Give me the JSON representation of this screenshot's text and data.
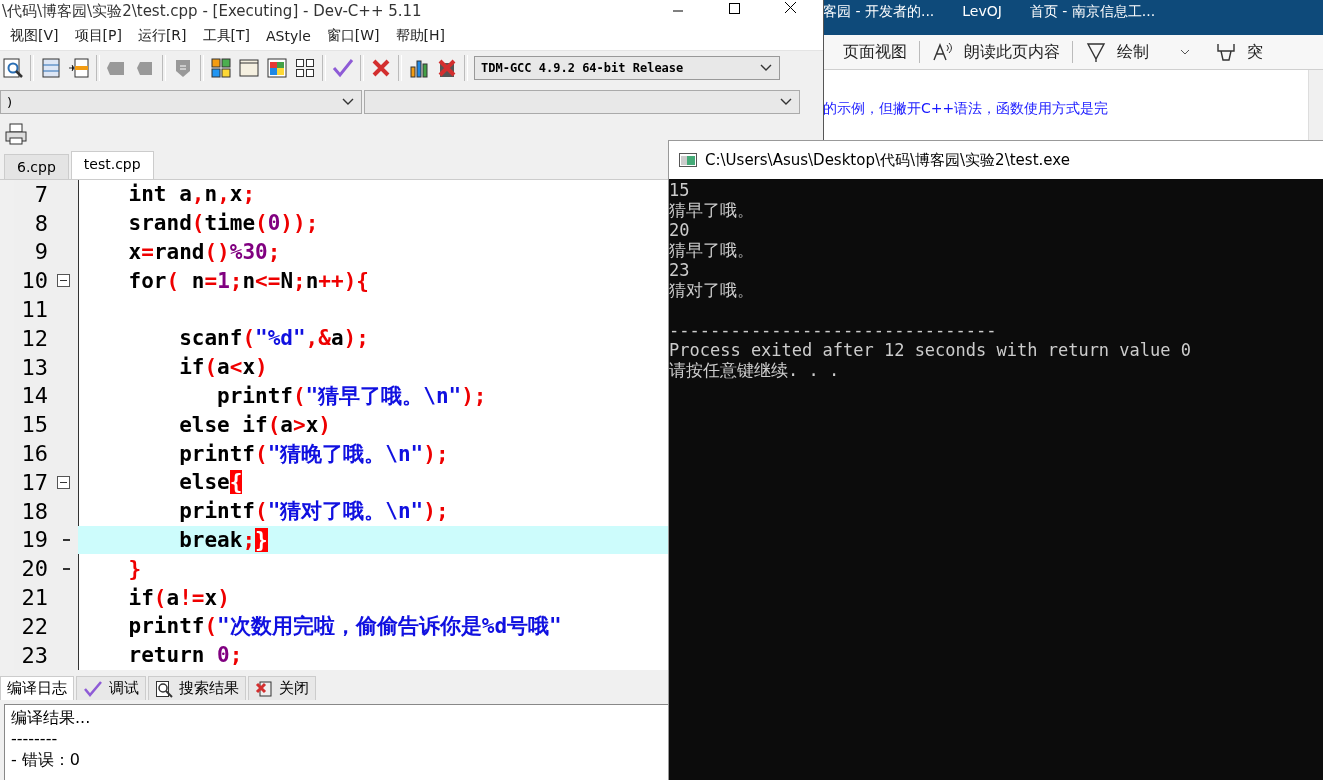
{
  "browser": {
    "tabs": [
      {
        "label": "客园 - 开发者的..."
      },
      {
        "label": "LevOJ"
      },
      {
        "label": "首页 - 南京信息工..."
      }
    ],
    "toolbar": [
      {
        "kind": "view",
        "label": "页面视图"
      },
      {
        "kind": "read",
        "label": "朗读此页内容"
      },
      {
        "kind": "draw",
        "label": "绘制"
      },
      {
        "kind": "highlight",
        "label": "突"
      }
    ],
    "content": "的示例，但撇开C++语法，函数使用方式是完"
  },
  "ide": {
    "title": "\\代码\\博客园\\实验2\\test.cpp - [Executing] - Dev-C++ 5.11",
    "menu": [
      "视图[V]",
      "项目[P]",
      "运行[R]",
      "工具[T]",
      "AStyle",
      "窗口[W]",
      "帮助[H]"
    ],
    "compiler": "TDM-GCC 4.9.2 64-bit Release",
    "class_dropdown": ")",
    "tabs": [
      {
        "label": "6.cpp",
        "selected": false
      },
      {
        "label": "test.cpp",
        "selected": true
      }
    ],
    "lines": [
      {
        "number": "7",
        "kind": "plain",
        "current": false,
        "tokens": [
          {
            "kind": "kw",
            "text": "    int "
          },
          {
            "kind": "id",
            "text": "a"
          },
          {
            "kind": "op",
            "text": ","
          },
          {
            "kind": "id",
            "text": "n"
          },
          {
            "kind": "op",
            "text": ","
          },
          {
            "kind": "id",
            "text": "x"
          },
          {
            "kind": "op",
            "text": ";"
          }
        ]
      },
      {
        "number": "8",
        "kind": "plain",
        "current": false,
        "tokens": [
          {
            "kind": "id",
            "text": "    srand"
          },
          {
            "kind": "op",
            "text": "("
          },
          {
            "kind": "id",
            "text": "time"
          },
          {
            "kind": "op",
            "text": "("
          },
          {
            "kind": "num",
            "text": "0"
          },
          {
            "kind": "op",
            "text": "));"
          }
        ]
      },
      {
        "number": "9",
        "kind": "plain",
        "current": false,
        "tokens": [
          {
            "kind": "id",
            "text": "    x"
          },
          {
            "kind": "op",
            "text": "="
          },
          {
            "kind": "id",
            "text": "rand"
          },
          {
            "kind": "op",
            "text": "()"
          },
          {
            "kind": "num",
            "text": "%30"
          },
          {
            "kind": "op",
            "text": ";"
          }
        ]
      },
      {
        "number": "10",
        "kind": "fold_start",
        "current": false,
        "tokens": [
          {
            "kind": "kw",
            "text": "    for"
          },
          {
            "kind": "op",
            "text": "( "
          },
          {
            "kind": "id",
            "text": "n"
          },
          {
            "kind": "op",
            "text": "="
          },
          {
            "kind": "num",
            "text": "1"
          },
          {
            "kind": "op",
            "text": ";"
          },
          {
            "kind": "id",
            "text": "n"
          },
          {
            "kind": "op",
            "text": "<="
          },
          {
            "kind": "id",
            "text": "N"
          },
          {
            "kind": "op",
            "text": ";"
          },
          {
            "kind": "id",
            "text": "n"
          },
          {
            "kind": "op",
            "text": "++){"
          }
        ]
      },
      {
        "number": "11",
        "kind": "plain",
        "current": false
      },
      {
        "number": "12",
        "kind": "plain",
        "current": false,
        "tokens": [
          {
            "kind": "id",
            "text": "        scanf"
          },
          {
            "kind": "op",
            "text": "("
          },
          {
            "kind": "str",
            "text": "\"%d\""
          },
          {
            "kind": "op",
            "text": ",&"
          },
          {
            "kind": "id",
            "text": "a"
          },
          {
            "kind": "op",
            "text": ");"
          }
        ]
      },
      {
        "number": "13",
        "kind": "plain",
        "current": false,
        "tokens": [
          {
            "kind": "kw",
            "text": "        if"
          },
          {
            "kind": "op",
            "text": "("
          },
          {
            "kind": "id",
            "text": "a"
          },
          {
            "kind": "op",
            "text": "<"
          },
          {
            "kind": "id",
            "text": "x"
          },
          {
            "kind": "op",
            "text": ")"
          }
        ]
      },
      {
        "number": "14",
        "kind": "plain",
        "current": false,
        "tokens": [
          {
            "kind": "id",
            "text": "           printf"
          },
          {
            "kind": "op",
            "text": "("
          },
          {
            "kind": "str",
            "text": "\"猜早了哦。\\n\""
          },
          {
            "kind": "op",
            "text": ");"
          }
        ]
      },
      {
        "number": "15",
        "kind": "plain",
        "current": false,
        "tokens": [
          {
            "kind": "kw",
            "text": "        else if"
          },
          {
            "kind": "op",
            "text": "("
          },
          {
            "kind": "id",
            "text": "a"
          },
          {
            "kind": "op",
            "text": ">"
          },
          {
            "kind": "id",
            "text": "x"
          },
          {
            "kind": "op",
            "text": ")"
          }
        ]
      },
      {
        "number": "16",
        "kind": "plain",
        "current": false,
        "tokens": [
          {
            "kind": "id",
            "text": "        printf"
          },
          {
            "kind": "op",
            "text": "("
          },
          {
            "kind": "str",
            "text": "\"猜晚了哦。\\n\""
          },
          {
            "kind": "op",
            "text": ");"
          }
        ]
      },
      {
        "number": "17",
        "kind": "fold_start",
        "current": false,
        "tokens": [
          {
            "kind": "kw",
            "text": "        else"
          },
          {
            "kind": "match",
            "text": "{"
          }
        ]
      },
      {
        "number": "18",
        "kind": "plain",
        "current": false,
        "tokens": [
          {
            "kind": "id",
            "text": "        printf"
          },
          {
            "kind": "op",
            "text": "("
          },
          {
            "kind": "str",
            "text": "\"猜对了哦。\\n\""
          },
          {
            "kind": "op",
            "text": ");"
          }
        ]
      },
      {
        "number": "19",
        "kind": "fold_end",
        "current": true,
        "tokens": [
          {
            "kind": "kw",
            "text": "        break"
          },
          {
            "kind": "op",
            "text": ";"
          },
          {
            "kind": "match",
            "text": "}"
          }
        ]
      },
      {
        "number": "20",
        "kind": "fold_end",
        "current": false,
        "tokens": [
          {
            "kind": "op",
            "text": "    }"
          }
        ]
      },
      {
        "number": "21",
        "kind": "plain",
        "current": false,
        "tokens": [
          {
            "kind": "kw",
            "text": "    if"
          },
          {
            "kind": "op",
            "text": "("
          },
          {
            "kind": "id",
            "text": "a"
          },
          {
            "kind": "op",
            "text": "!="
          },
          {
            "kind": "id",
            "text": "x"
          },
          {
            "kind": "op",
            "text": ")"
          }
        ]
      },
      {
        "number": "22",
        "kind": "plain",
        "current": false,
        "tokens": [
          {
            "kind": "id",
            "text": "    printf"
          },
          {
            "kind": "op",
            "text": "("
          },
          {
            "kind": "str",
            "text": "\"次数用完啦，偷偷告诉你是%d号哦\""
          }
        ]
      },
      {
        "number": "23",
        "kind": "plain",
        "current": false,
        "tokens": [
          {
            "kind": "kw",
            "text": "    return "
          },
          {
            "kind": "num",
            "text": "0"
          },
          {
            "kind": "op",
            "text": ";"
          }
        ]
      }
    ],
    "panel_tabs": [
      {
        "kind": "log",
        "label": "编译日志",
        "selected": true
      },
      {
        "kind": "debug",
        "label": "调试",
        "selected": false
      },
      {
        "kind": "search",
        "label": "搜索结果",
        "selected": false
      },
      {
        "kind": "close",
        "label": "关闭",
        "selected": false
      }
    ],
    "log": [
      "编译结果...",
      "--------",
      "- 错误：0"
    ]
  },
  "console": {
    "title": "C:\\Users\\Asus\\Desktop\\代码\\博客园\\实验2\\test.exe",
    "lines": [
      {
        "kind": "text",
        "text": "15"
      },
      {
        "kind": "text",
        "text": "猜早了哦。"
      },
      {
        "kind": "text",
        "text": "20"
      },
      {
        "kind": "text",
        "text": "猜早了哦。"
      },
      {
        "kind": "text",
        "text": "23"
      },
      {
        "kind": "text",
        "text": "猜对了哦。"
      },
      {
        "kind": "gap"
      },
      {
        "kind": "text",
        "text": "--------------------------------"
      },
      {
        "kind": "text",
        "text": "Process exited after 12 seconds with return value 0"
      },
      {
        "kind": "text",
        "text": "请按任意键继续. . ."
      }
    ]
  }
}
